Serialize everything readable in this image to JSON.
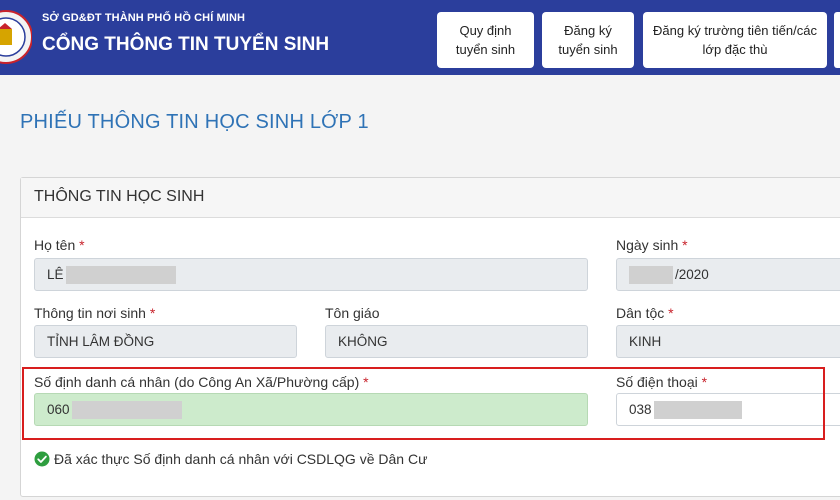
{
  "header": {
    "org": "SỞ GD&ĐT THÀNH PHỐ HỒ CHÍ MINH",
    "title": "CỔNG THÔNG TIN TUYỂN SINH",
    "nav": [
      {
        "label": "Quy định\ntuyển sinh"
      },
      {
        "label": "Đăng ký\ntuyển sinh"
      },
      {
        "label": "Đăng ký trường tiên tiến/các\nlớp đặc thù"
      }
    ]
  },
  "page": {
    "title": "PHIẾU THÔNG TIN HỌC SINH LỚP 1"
  },
  "panel": {
    "title": "THÔNG TIN HỌC SINH",
    "fields": {
      "ho_ten": {
        "label": "Họ tên",
        "required": "*",
        "value": "LÊ"
      },
      "ngay_sinh": {
        "label": "Ngày sinh",
        "required": "*",
        "value": "/2020"
      },
      "noi_sinh": {
        "label": "Thông tin nơi sinh",
        "required": "*",
        "value": "TỈNH LÂM ĐỒNG"
      },
      "ton_giao": {
        "label": "Tôn giáo",
        "value": "KHÔNG"
      },
      "dan_toc": {
        "label": "Dân tộc",
        "required": "*",
        "value": "KINH"
      },
      "so_dinh_danh": {
        "label": "Số định danh cá nhân (do Công An Xã/Phường cấp)",
        "required": "*",
        "value": "060"
      },
      "so_dien_thoai": {
        "label": "Số điện thoại",
        "required": "*",
        "value": "038"
      }
    },
    "verify_text": "Đã xác thực Số định danh cá nhân với CSDLQG về Dân Cư"
  },
  "colors": {
    "header_bg": "#2b3e9c",
    "title_blue": "#2f73b6",
    "required_red": "#c8232c",
    "highlight_red": "#d81e1e",
    "verified_green": "#cdebcc",
    "check_green": "#2e9e3f"
  }
}
